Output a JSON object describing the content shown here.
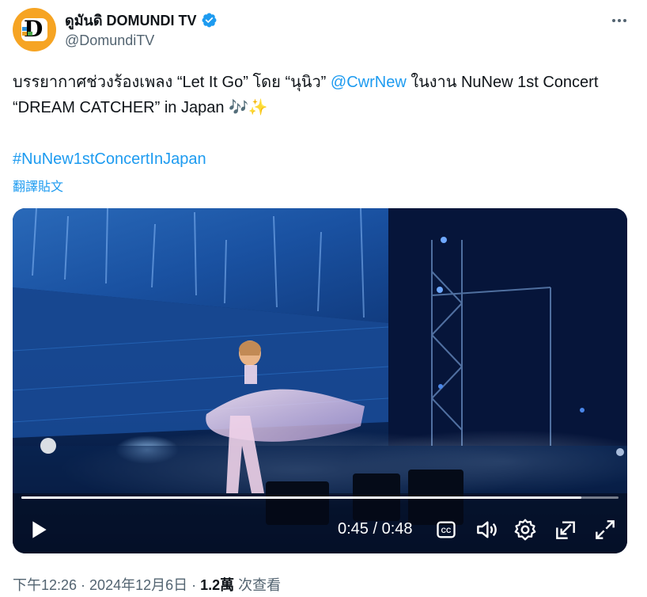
{
  "author": {
    "display_name": "ดูมันดิ DOMUNDI TV",
    "handle": "@DomundiTV",
    "avatar_icon": "domundi-logo",
    "avatar_color": "#f6a423",
    "verified_color": "#1d9bf0"
  },
  "tweet": {
    "text_1": "บรรยากาศช่วงร้องเพลง “Let It Go” โดย “นุนิว” ",
    "mention": "@CwrNew",
    "text_2": " ในงาน NuNew 1st Concert “DREAM CATCHER” in Japan ",
    "emoji": "🎶✨",
    "hashtag": "#NuNew1stConcertInJapan",
    "translate": "翻譯貼文"
  },
  "video": {
    "time_display": "0:45 / 0:48",
    "progress_fraction": 0.9375,
    "icons": [
      "play-icon",
      "captions-icon",
      "volume-icon",
      "settings-icon",
      "popout-icon",
      "fullscreen-icon"
    ]
  },
  "meta": {
    "time": "下午12:26",
    "date": "2024年12月6日",
    "separator": " · ",
    "views_count": "1.2萬",
    "views_label": " 次查看"
  },
  "colors": {
    "link": "#1d9bf0",
    "secondary_text": "#536471",
    "primary_text": "#0f1419"
  }
}
